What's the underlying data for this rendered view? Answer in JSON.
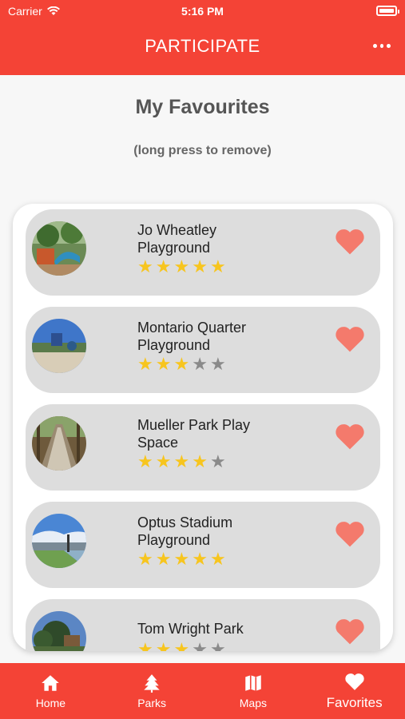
{
  "status_bar": {
    "carrier": "Carrier",
    "time": "5:16 PM"
  },
  "header": {
    "title": "PARTICIPATE"
  },
  "page": {
    "title": "My Favourites",
    "subtitle": "(long press to remove)"
  },
  "favourites": [
    {
      "name": "Jo Wheatley Playground",
      "rating": 5
    },
    {
      "name": "Montario Quarter Playground",
      "rating": 3
    },
    {
      "name": "Mueller Park Play Space",
      "rating": 4
    },
    {
      "name": "Optus Stadium Playground",
      "rating": 5
    },
    {
      "name": "Tom Wright Park",
      "rating": 3
    }
  ],
  "nav": [
    {
      "label": "Home",
      "icon": "home-icon"
    },
    {
      "label": "Parks",
      "icon": "tree-icon"
    },
    {
      "label": "Maps",
      "icon": "map-icon"
    },
    {
      "label": "Favorites",
      "icon": "heart-icon",
      "active": true
    }
  ],
  "colors": {
    "accent": "#f44336",
    "star_on": "#f7c51e",
    "star_off": "#8a8a8a",
    "heart": "#f47a6c"
  }
}
